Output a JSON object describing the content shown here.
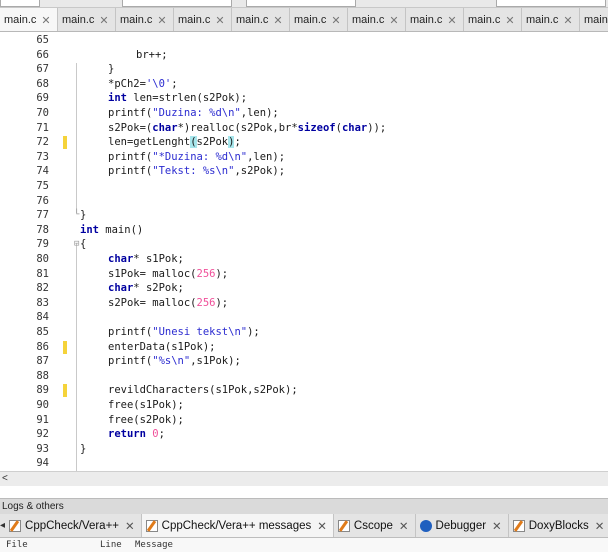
{
  "tabs": [
    {
      "label": "main.c",
      "close": "✕"
    },
    {
      "label": "main.c",
      "close": "✕"
    },
    {
      "label": "main.c",
      "close": "✕"
    },
    {
      "label": "main.c",
      "close": "✕"
    },
    {
      "label": "main.c",
      "close": "✕"
    },
    {
      "label": "main.c",
      "close": "✕"
    },
    {
      "label": "main.c",
      "close": "✕"
    },
    {
      "label": "main.c",
      "close": "✕"
    },
    {
      "label": "main.c",
      "close": "✕"
    },
    {
      "label": "main.c",
      "close": "✕"
    },
    {
      "label": "main.",
      "close": ""
    }
  ],
  "editor": {
    "lines": [
      {
        "n": "65",
        "code": ""
      },
      {
        "n": "66",
        "code": "br++;"
      },
      {
        "n": "67",
        "code": "}"
      },
      {
        "n": "68",
        "code": "*pCh2='\\0';"
      },
      {
        "n": "69",
        "code": "int len=strlen(s2Pok);"
      },
      {
        "n": "70",
        "code": "printf(\"Duzina: %d\\n\",len);"
      },
      {
        "n": "71",
        "code": "s2Pok=(char*)realloc(s2Pok,br*sizeof(char));"
      },
      {
        "n": "72",
        "code": "len=getLenght(s2Pok);"
      },
      {
        "n": "73",
        "code": "printf(\"*Duzina: %d\\n\",len);"
      },
      {
        "n": "74",
        "code": "printf(\"Tekst: %s\\n\",s2Pok);"
      },
      {
        "n": "75",
        "code": ""
      },
      {
        "n": "76",
        "code": ""
      },
      {
        "n": "77",
        "code": "}"
      },
      {
        "n": "78",
        "code": "int main()"
      },
      {
        "n": "79",
        "code": "{"
      },
      {
        "n": "80",
        "code": "char* s1Pok;"
      },
      {
        "n": "81",
        "code": "s1Pok= malloc(256);"
      },
      {
        "n": "82",
        "code": "char* s2Pok;"
      },
      {
        "n": "83",
        "code": "s2Pok= malloc(256);"
      },
      {
        "n": "84",
        "code": ""
      },
      {
        "n": "85",
        "code": "printf(\"Unesi tekst\\n\");"
      },
      {
        "n": "86",
        "code": "enterData(s1Pok);"
      },
      {
        "n": "87",
        "code": "printf(\"%s\\n\",s1Pok);"
      },
      {
        "n": "88",
        "code": ""
      },
      {
        "n": "89",
        "code": "revildCharacters(s1Pok,s2Pok);"
      },
      {
        "n": "90",
        "code": "free(s1Pok);"
      },
      {
        "n": "91",
        "code": "free(s2Pok);"
      },
      {
        "n": "92",
        "code": "return 0;"
      },
      {
        "n": "93",
        "code": "}"
      },
      {
        "n": "94",
        "code": ""
      }
    ]
  },
  "scrollbar": {
    "left_arrow": "<"
  },
  "logs": {
    "title": "Logs & others",
    "nav_arrow": "◂",
    "tabs": [
      {
        "label": "CppCheck/Vera++",
        "close": "✕",
        "icon": "pencil-icon"
      },
      {
        "label": "CppCheck/Vera++ messages",
        "close": "✕",
        "icon": "pencil-icon"
      },
      {
        "label": "Cscope",
        "close": "✕",
        "icon": "pencil-icon"
      },
      {
        "label": "Debugger",
        "close": "✕",
        "icon": "bug-icon"
      },
      {
        "label": "DoxyBlocks",
        "close": "✕",
        "icon": "pencil-icon"
      }
    ],
    "columns": [
      "File",
      "Line",
      "Message"
    ]
  },
  "colors": {
    "keyword": "#0000a0",
    "string": "#2b2bd0",
    "number": "#f0509a",
    "change_marker": "#f5d33a",
    "brace_highlight": "#a7e6ec"
  }
}
